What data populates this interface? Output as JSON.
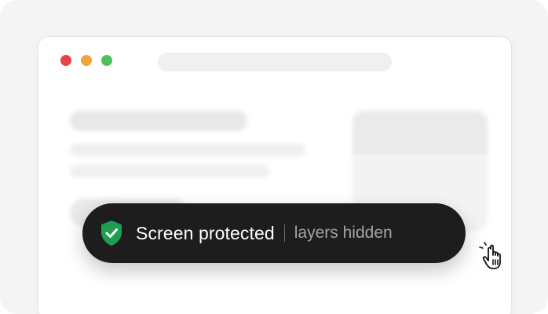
{
  "window": {
    "controls": [
      {
        "name": "close",
        "color": "#e8434a"
      },
      {
        "name": "minimize",
        "color": "#f0a43a"
      },
      {
        "name": "maximize",
        "color": "#4cc159"
      }
    ],
    "address_bar_placeholder": ""
  },
  "toast": {
    "icon": "shield-check-icon",
    "icon_color": "#1e9e50",
    "background": "#1d1d1d",
    "title": "Screen protected",
    "subtitle": "layers hidden"
  },
  "cursor": {
    "icon": "hand-pointer-icon"
  }
}
